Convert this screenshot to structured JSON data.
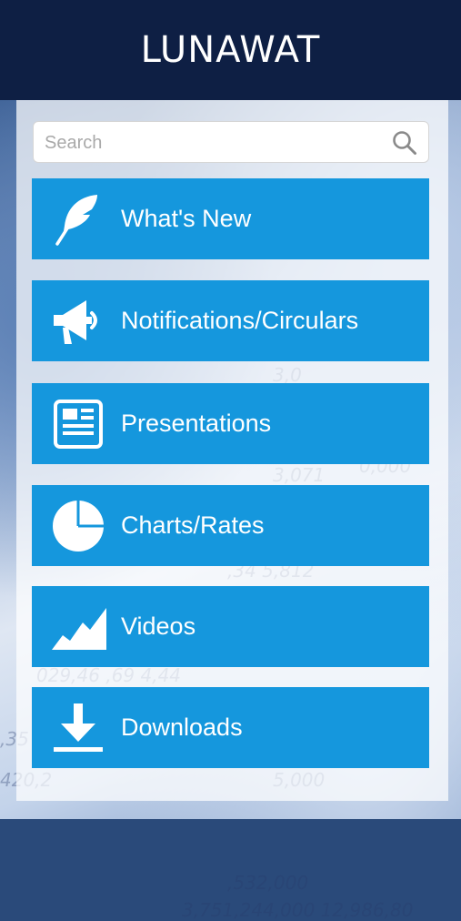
{
  "header": {
    "title": "LUNAWAT"
  },
  "search": {
    "placeholder": "Search"
  },
  "menu": [
    {
      "label": "What's New",
      "icon": "feather-icon"
    },
    {
      "label": "Notifications/Circulars",
      "icon": "megaphone-icon"
    },
    {
      "label": "Presentations",
      "icon": "newspaper-icon"
    },
    {
      "label": "Charts/Rates",
      "icon": "pie-chart-icon"
    },
    {
      "label": "Videos",
      "icon": "area-chart-icon"
    },
    {
      "label": "Downloads",
      "icon": "download-icon"
    }
  ],
  "colors": {
    "header_bg": "#0e1f44",
    "button_bg": "#1597dd",
    "text_light": "#ffffff"
  }
}
